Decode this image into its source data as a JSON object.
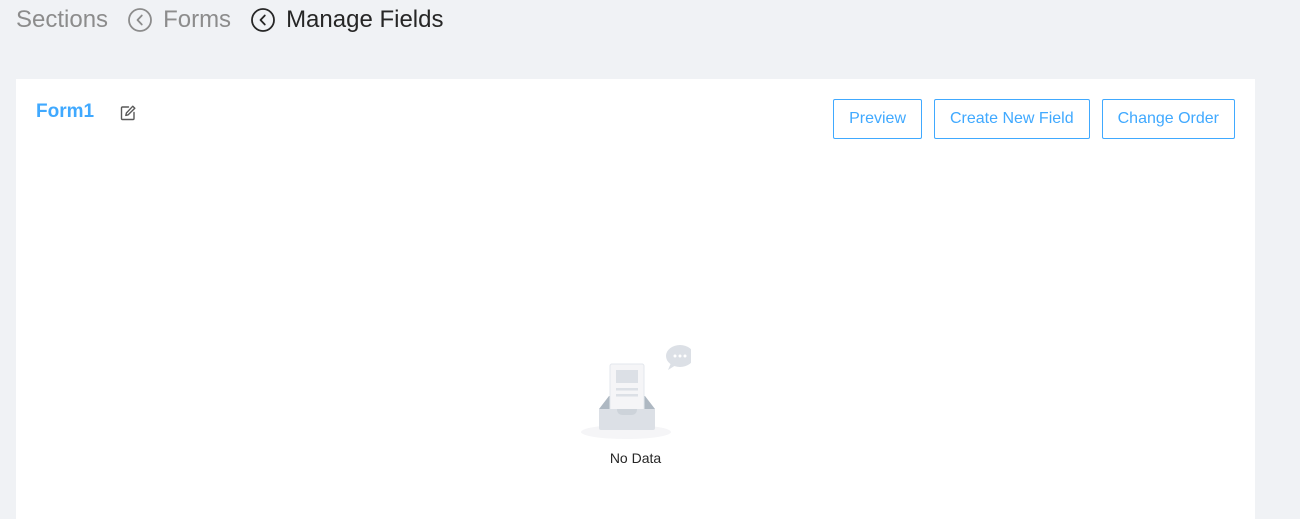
{
  "breadcrumb": {
    "items": [
      {
        "label": "Sections"
      },
      {
        "label": "Forms"
      },
      {
        "label": "Manage Fields"
      }
    ]
  },
  "form": {
    "title": "Form1"
  },
  "actions": {
    "preview_label": "Preview",
    "create_label": "Create New Field",
    "order_label": "Change Order"
  },
  "empty_state": {
    "text": "No Data"
  },
  "colors": {
    "accent": "#40a9ff",
    "background": "#f0f2f5",
    "card": "#ffffff",
    "muted_text": "#8c8c8c",
    "text": "#262626"
  },
  "icons": {
    "breadcrumb_separator": "chevron-left-circle-icon",
    "edit": "edit-icon",
    "empty": "empty-inbox-icon"
  }
}
